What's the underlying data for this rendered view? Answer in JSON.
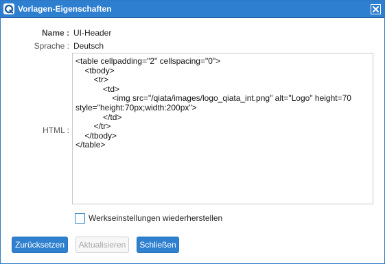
{
  "window": {
    "title": "Vorlagen-Eigenschaften",
    "app_icon": "qiata-logo-icon",
    "close_icon": "close-icon",
    "accent_color": "#2f7fd0"
  },
  "form": {
    "name_label": "Name :",
    "name_value": "UI-Header",
    "language_label": "Sprache :",
    "language_value": "Deutsch",
    "html_label": "HTML :",
    "html_value": "<table cellpadding=\"2\" cellspacing=\"0\">\n    <tbody>\n        <tr>\n            <td>\n                <img src=\"/qiata/images/logo_qiata_int.png\" alt=\"Logo\" height=70 style=\"height:70px;width:200px\">\n            </td>\n        </tr>\n    </tbody>\n</table>",
    "restore_defaults_label": "Werkseinstellungen wiederherstellen",
    "restore_defaults_checked": false
  },
  "buttons": {
    "reset_label": "Zurücksetzen",
    "update_label": "Aktualisieren",
    "update_enabled": false,
    "close_label": "Schließen"
  }
}
